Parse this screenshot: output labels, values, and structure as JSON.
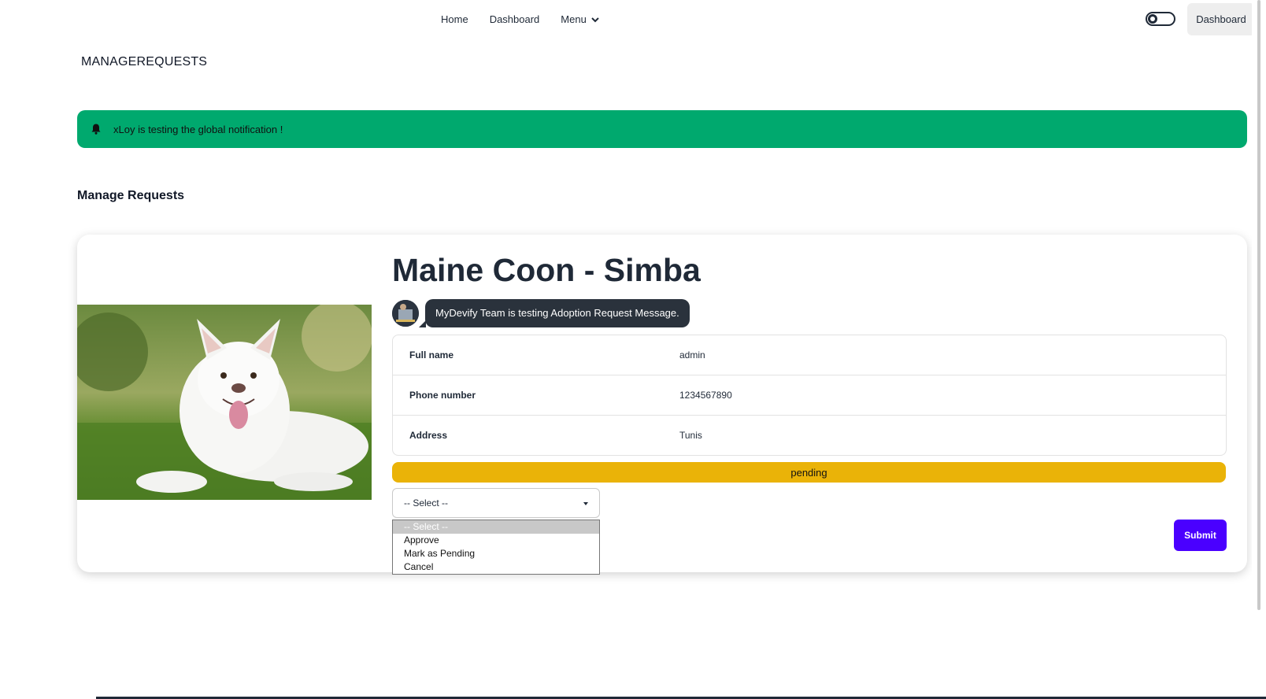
{
  "nav": {
    "links": {
      "home": "Home",
      "dashboard": "Dashboard",
      "menu": "Menu"
    },
    "dashboard_button": "Dashboard"
  },
  "page_header": "MANAGEREQUESTS",
  "notification": {
    "text": "xLoy is testing the global notification !",
    "color": "#00a96e"
  },
  "section_title": "Manage Requests",
  "request": {
    "title": "Maine Coon - Simba",
    "message": "MyDevify Team is testing Adoption Request Message.",
    "details": [
      {
        "label": "Full name",
        "value": "admin"
      },
      {
        "label": "Phone number",
        "value": "1234567890"
      },
      {
        "label": "Address",
        "value": "Tunis"
      }
    ],
    "status": "pending",
    "status_color": "#eab308"
  },
  "action_select": {
    "selected": "-- Select --",
    "options": [
      "-- Select --",
      "Approve",
      "Mark as Pending",
      "Cancel"
    ]
  },
  "submit_label": "Submit",
  "colors": {
    "accent": "#4a00ff",
    "chat_bubble": "#2a323c"
  },
  "icons": {
    "bell": "bell-icon",
    "chevron": "chevron-down-icon",
    "theme_toggle": "theme-toggle-icon"
  }
}
